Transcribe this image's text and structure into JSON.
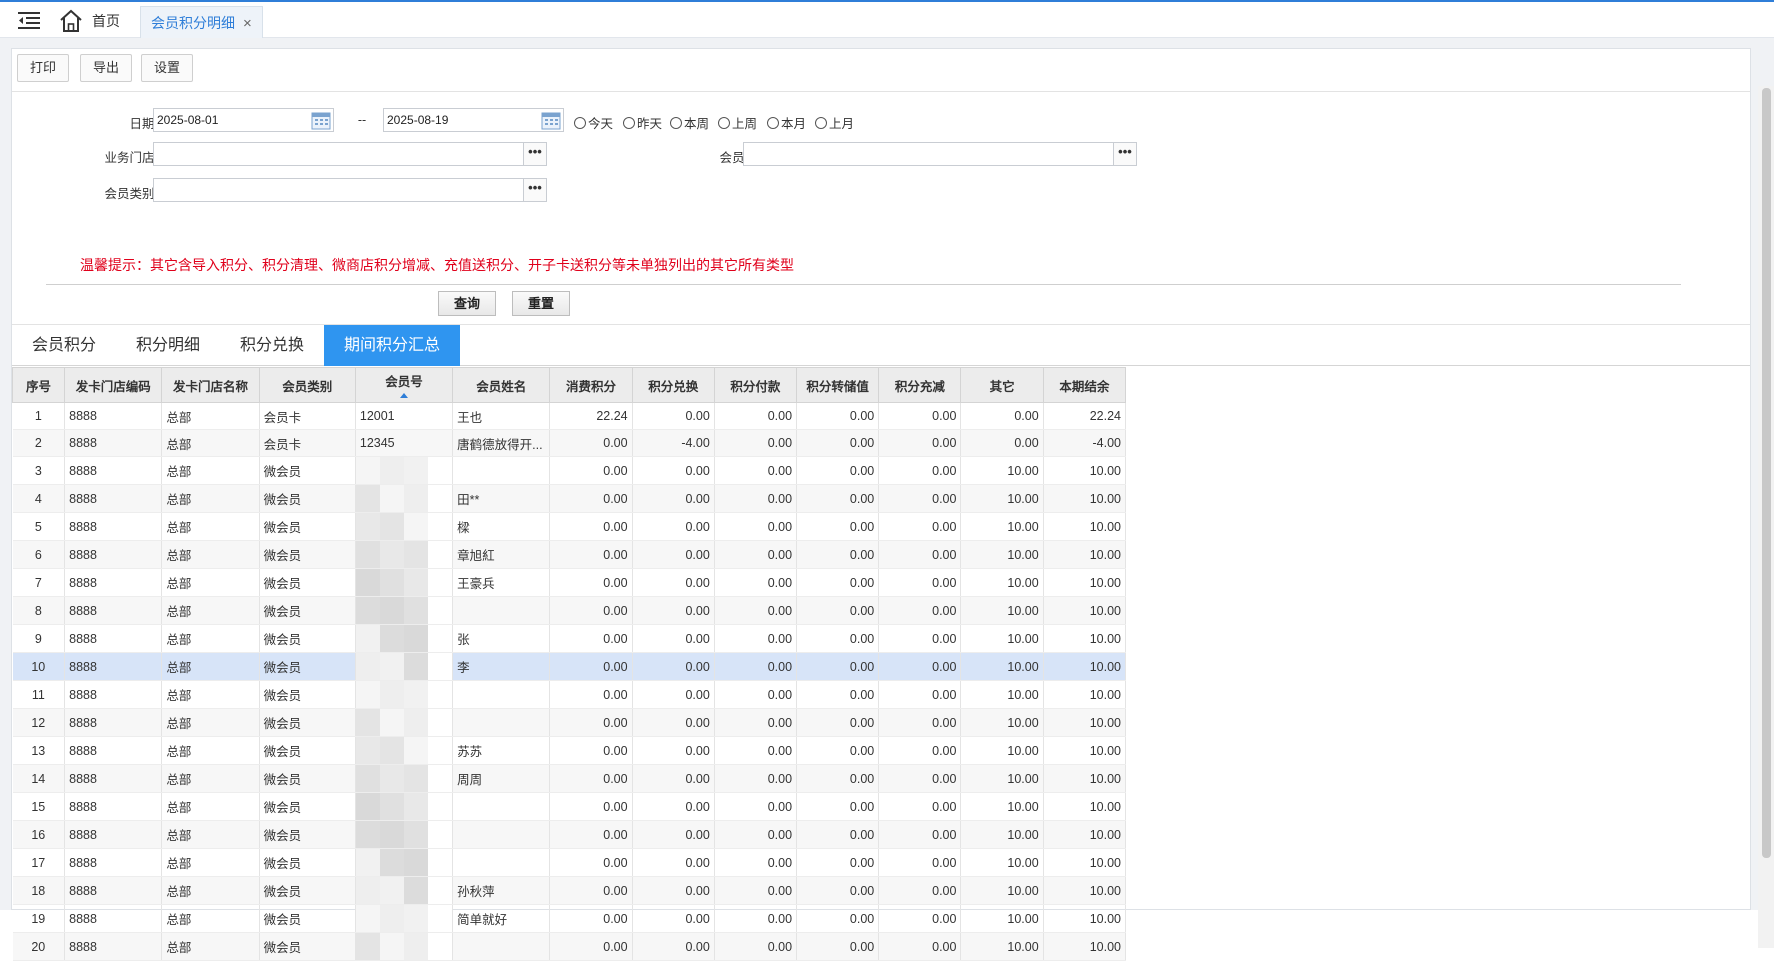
{
  "topbar": {
    "home_label": "首页",
    "active_tab_label": "会员积分明细",
    "close_glyph": "×",
    "icons": [
      "menu-toggle-icon",
      "home-icon",
      "close-icon"
    ]
  },
  "toolbar": {
    "print": "打印",
    "export": "导出",
    "settings": "设置"
  },
  "filters": {
    "date_label": "日期:",
    "date_from": "2025-08-01",
    "date_sep": "--",
    "date_to": "2025-08-19",
    "quick_ranges": [
      "今天",
      "昨天",
      "本周",
      "上周",
      "本月",
      "上月"
    ],
    "store_label": "业务门店:",
    "store_value": "",
    "member_label": "会员:",
    "member_value": "",
    "category_label": "会员类别:",
    "category_value": "",
    "picker_glyph": "•••",
    "tip": "温馨提示：其它含导入积分、积分清理、微商店积分增减、充值送积分、开子卡送积分等未单独列出的其它所有类型",
    "query_button": "查询",
    "reset_button": "重置"
  },
  "result_tabs": [
    "会员积分",
    "积分明细",
    "积分兑换",
    "期间积分汇总"
  ],
  "active_result_tab": "期间积分汇总",
  "grid": {
    "columns": [
      "序号",
      "发卡门店编码",
      "发卡门店名称",
      "会员类别",
      "会员号",
      "会员姓名",
      "消费积分",
      "积分兑换",
      "积分付款",
      "积分转储值",
      "积分充减",
      "其它",
      "本期结余"
    ],
    "sorted_column": "会员号",
    "selected_row": "10",
    "rows": [
      [
        "1",
        "8888",
        "总部",
        "会员卡",
        "12001",
        "王也",
        "22.24",
        "0.00",
        "0.00",
        "0.00",
        "0.00",
        "0.00",
        "22.24"
      ],
      [
        "2",
        "8888",
        "总部",
        "会员卡",
        "12345",
        "唐鹤德放得开...",
        "0.00",
        "-4.00",
        "0.00",
        "0.00",
        "0.00",
        "0.00",
        "-4.00"
      ],
      [
        "3",
        "8888",
        "总部",
        "微会员",
        "",
        "",
        "0.00",
        "0.00",
        "0.00",
        "0.00",
        "0.00",
        "10.00",
        "10.00"
      ],
      [
        "4",
        "8888",
        "总部",
        "微会员",
        "",
        "田**",
        "0.00",
        "0.00",
        "0.00",
        "0.00",
        "0.00",
        "10.00",
        "10.00"
      ],
      [
        "5",
        "8888",
        "总部",
        "微会员",
        "",
        "樑",
        "0.00",
        "0.00",
        "0.00",
        "0.00",
        "0.00",
        "10.00",
        "10.00"
      ],
      [
        "6",
        "8888",
        "总部",
        "微会员",
        "",
        "章旭紅",
        "0.00",
        "0.00",
        "0.00",
        "0.00",
        "0.00",
        "10.00",
        "10.00"
      ],
      [
        "7",
        "8888",
        "总部",
        "微会员",
        "",
        "王豪兵",
        "0.00",
        "0.00",
        "0.00",
        "0.00",
        "0.00",
        "10.00",
        "10.00"
      ],
      [
        "8",
        "8888",
        "总部",
        "微会员",
        "",
        "",
        "0.00",
        "0.00",
        "0.00",
        "0.00",
        "0.00",
        "10.00",
        "10.00"
      ],
      [
        "9",
        "8888",
        "总部",
        "微会员",
        "",
        "张",
        "0.00",
        "0.00",
        "0.00",
        "0.00",
        "0.00",
        "10.00",
        "10.00"
      ],
      [
        "10",
        "8888",
        "总部",
        "微会员",
        "",
        "李",
        "0.00",
        "0.00",
        "0.00",
        "0.00",
        "0.00",
        "10.00",
        "10.00"
      ],
      [
        "11",
        "8888",
        "总部",
        "微会员",
        "",
        "",
        "0.00",
        "0.00",
        "0.00",
        "0.00",
        "0.00",
        "10.00",
        "10.00"
      ],
      [
        "12",
        "8888",
        "总部",
        "微会员",
        "",
        "",
        "0.00",
        "0.00",
        "0.00",
        "0.00",
        "0.00",
        "10.00",
        "10.00"
      ],
      [
        "13",
        "8888",
        "总部",
        "微会员",
        "",
        "苏苏",
        "0.00",
        "0.00",
        "0.00",
        "0.00",
        "0.00",
        "10.00",
        "10.00"
      ],
      [
        "14",
        "8888",
        "总部",
        "微会员",
        "",
        "周周",
        "0.00",
        "0.00",
        "0.00",
        "0.00",
        "0.00",
        "10.00",
        "10.00"
      ],
      [
        "15",
        "8888",
        "总部",
        "微会员",
        "",
        "",
        "0.00",
        "0.00",
        "0.00",
        "0.00",
        "0.00",
        "10.00",
        "10.00"
      ],
      [
        "16",
        "8888",
        "总部",
        "微会员",
        "",
        "",
        "0.00",
        "0.00",
        "0.00",
        "0.00",
        "0.00",
        "10.00",
        "10.00"
      ],
      [
        "17",
        "8888",
        "总部",
        "微会员",
        "",
        "",
        "0.00",
        "0.00",
        "0.00",
        "0.00",
        "0.00",
        "10.00",
        "10.00"
      ],
      [
        "18",
        "8888",
        "总部",
        "微会员",
        "",
        "孙秋萍",
        "0.00",
        "0.00",
        "0.00",
        "0.00",
        "0.00",
        "10.00",
        "10.00"
      ],
      [
        "19",
        "8888",
        "总部",
        "微会员",
        "",
        "简单就好",
        "0.00",
        "0.00",
        "0.00",
        "0.00",
        "0.00",
        "10.00",
        "10.00"
      ],
      [
        "20",
        "8888",
        "总部",
        "微会员",
        "",
        "",
        "0.00",
        "0.00",
        "0.00",
        "0.00",
        "0.00",
        "10.00",
        "10.00"
      ]
    ]
  },
  "colors": {
    "accent": "#2f95f0",
    "tip": "#e0001b",
    "selected_row": "#d7e4f8",
    "link": "#2f7ed8"
  }
}
